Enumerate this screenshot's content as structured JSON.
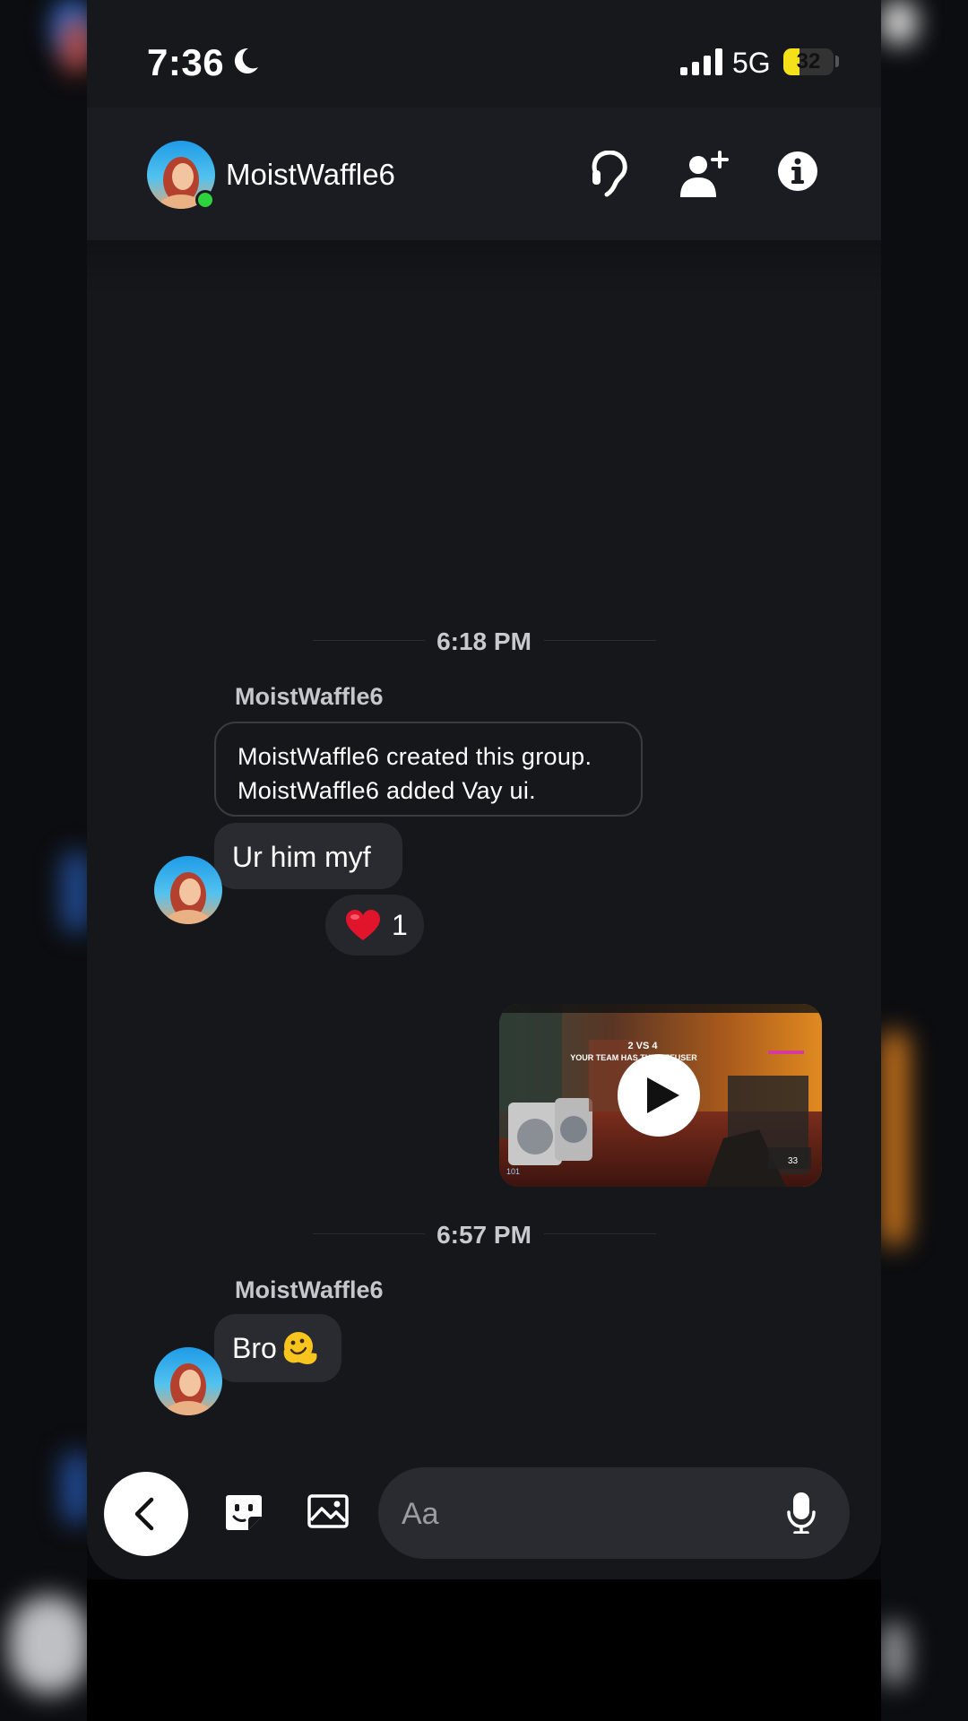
{
  "status_bar": {
    "time": "7:36",
    "network": "5G",
    "battery": "32",
    "battery_level": 0.32
  },
  "header": {
    "contact_name": "MoistWaffle6",
    "online": true,
    "icons": [
      "headset-icon",
      "add-person-icon",
      "info-icon"
    ]
  },
  "messages": {
    "group1_time": "6:18 PM",
    "group1_sender": "MoistWaffle6",
    "system_line1": "MoistWaffle6 created this group.",
    "system_line2": "MoistWaffle6 added Vay ui.",
    "text1": "Ur him myf",
    "reaction_emoji": "❤️",
    "reaction_count": "1",
    "video": {
      "overlay_text1": "2 VS 4",
      "overlay_text2": "YOUR TEAM HAS THE DEFUSER",
      "hud_left": "101",
      "hud_right": "33"
    },
    "group2_time": "6:57 PM",
    "group2_sender": "MoistWaffle6",
    "text2": "Bro",
    "text2_emoji": "🫠"
  },
  "composer": {
    "placeholder": "Aa",
    "icons": [
      "back-chevron-icon",
      "sticker-icon",
      "image-icon",
      "microphone-icon"
    ]
  },
  "colors": {
    "background": "#16171b",
    "bubble": "#2a2b30",
    "online": "#2ed23f",
    "battery": "#f5e11a",
    "heart": "#e0152b"
  }
}
